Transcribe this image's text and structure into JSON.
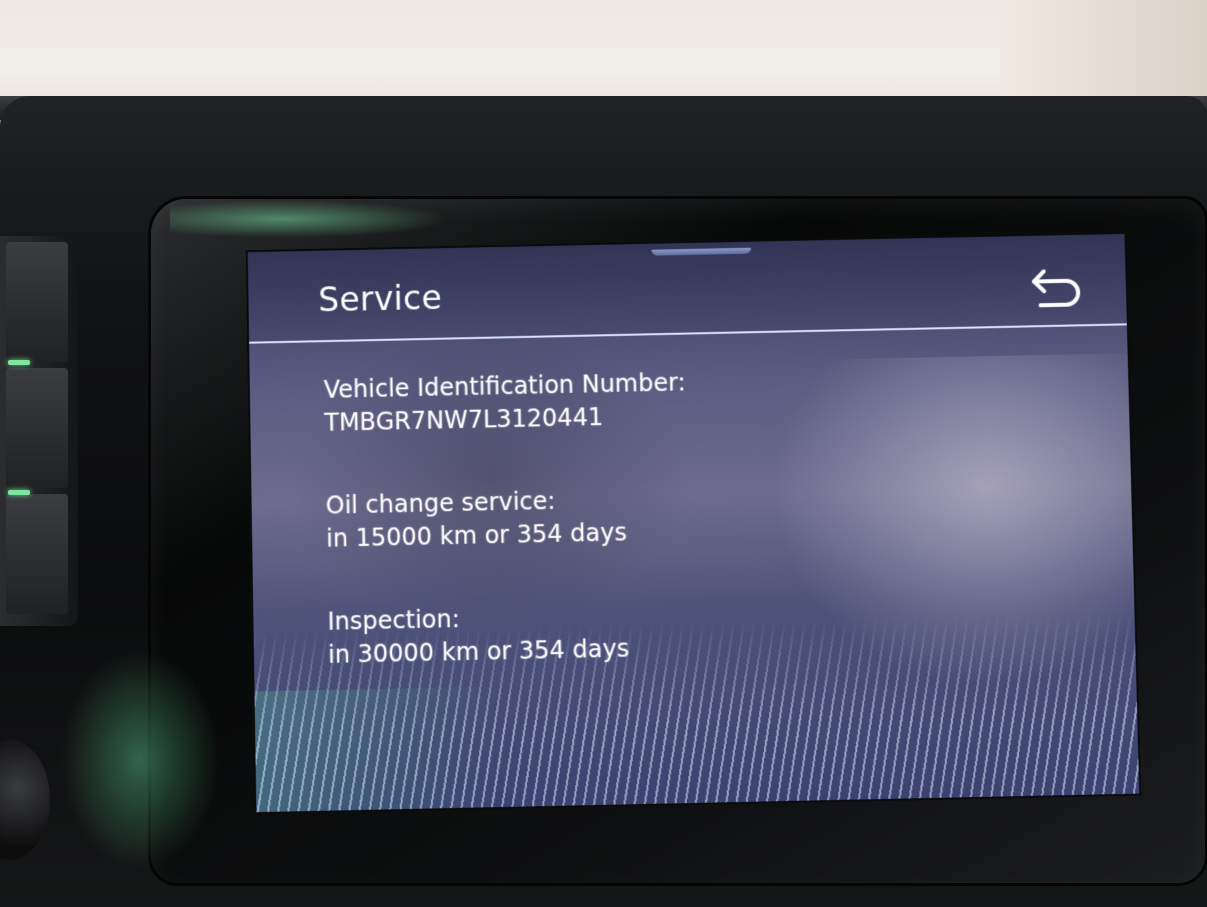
{
  "screen": {
    "title": "Service",
    "back_icon": "back-arrow-icon",
    "accent_color": "#d9e2ff"
  },
  "vin": {
    "label": "Vehicle Identification Number:",
    "value": "TMBGR7NW7L3120441"
  },
  "oil_change": {
    "label": "Oil change service:",
    "value": "in 15000 km or 354 days"
  },
  "inspection": {
    "label": "Inspection:",
    "value": "in 30000 km or 354 days"
  }
}
